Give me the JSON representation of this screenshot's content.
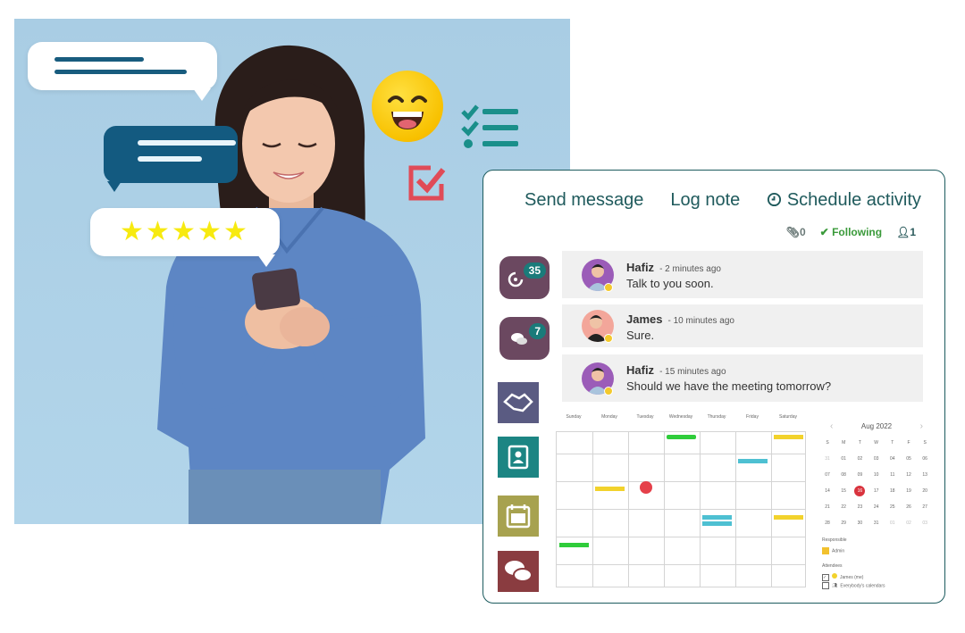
{
  "hero": {
    "review_stars": 5,
    "emoji": "grinning-face",
    "colors": {
      "bubble_dark": "#135a80",
      "star": "#f7ea10",
      "check_red": "#e04b57",
      "checklist_teal": "#1a8f8a"
    }
  },
  "chatter": {
    "actions": [
      "Send message",
      "Log note",
      "Schedule activity"
    ],
    "schedule_icon": "clock-icon",
    "stats": {
      "attachments": "0",
      "following_label": "Following",
      "followers": "1"
    },
    "side_buttons": [
      {
        "icon": "activity-icon",
        "badge": "35"
      },
      {
        "icon": "discuss-icon",
        "badge": "7"
      }
    ],
    "apps": [
      {
        "icon": "handshake-icon",
        "color": "#5a5b82"
      },
      {
        "icon": "contacts-icon",
        "color": "#1c8583"
      },
      {
        "icon": "calendar-icon",
        "color": "#a7a24f"
      },
      {
        "icon": "chat-icon",
        "color": "#8a3c40"
      }
    ],
    "messages": [
      {
        "author": "Hafiz",
        "time": "- 2 minutes ago",
        "text": "Talk to you soon."
      },
      {
        "author": "James",
        "time": "- 10 minutes ago",
        "text": "Sure."
      },
      {
        "author": "Hafiz",
        "time": "- 15  minutes ago",
        "text": "Should we have the meeting tomorrow?"
      }
    ]
  },
  "calendar": {
    "weekdays": [
      "Sunday",
      "Monday",
      "Tuesday",
      "Wednesday",
      "Thursday",
      "Friday",
      "Saturday"
    ],
    "events": [
      {
        "row": 0,
        "col": 3,
        "color": "#2fcc3a"
      },
      {
        "row": 0,
        "col": 6,
        "color": "#f2d22c"
      },
      {
        "row": 1,
        "col": 5,
        "color": "#4ec0d2"
      },
      {
        "row": 2,
        "col": 1,
        "color": "#f2d22c"
      },
      {
        "row": 3,
        "col": 4,
        "color": "#4ec0d2"
      },
      {
        "row": 3,
        "col": 4,
        "color": "#4ec0d2"
      },
      {
        "row": 3,
        "col": 6,
        "color": "#f2d22c"
      },
      {
        "row": 4,
        "col": 0,
        "color": "#2fcc3a"
      }
    ],
    "marker": {
      "row": 1,
      "col": 2,
      "color": "#e5404a"
    },
    "mini": {
      "month": "Aug 2022",
      "day_initials": [
        "S",
        "M",
        "T",
        "W",
        "T",
        "F",
        "S"
      ],
      "weeks": [
        [
          "31",
          "01",
          "02",
          "03",
          "04",
          "05",
          "06"
        ],
        [
          "07",
          "08",
          "09",
          "10",
          "11",
          "12",
          "13"
        ],
        [
          "14",
          "15",
          "16",
          "17",
          "18",
          "19",
          "20"
        ],
        [
          "21",
          "22",
          "23",
          "24",
          "25",
          "26",
          "27"
        ],
        [
          "28",
          "29",
          "30",
          "31",
          "01",
          "02",
          "03"
        ]
      ],
      "today": "16"
    },
    "responsible_label": "Responsible",
    "responsible": "Admin",
    "attendees_label": "Attendees",
    "attendees": [
      {
        "name": "James (me)",
        "checked": true
      },
      {
        "name": "Everybody's calendars",
        "checked": false
      }
    ]
  }
}
